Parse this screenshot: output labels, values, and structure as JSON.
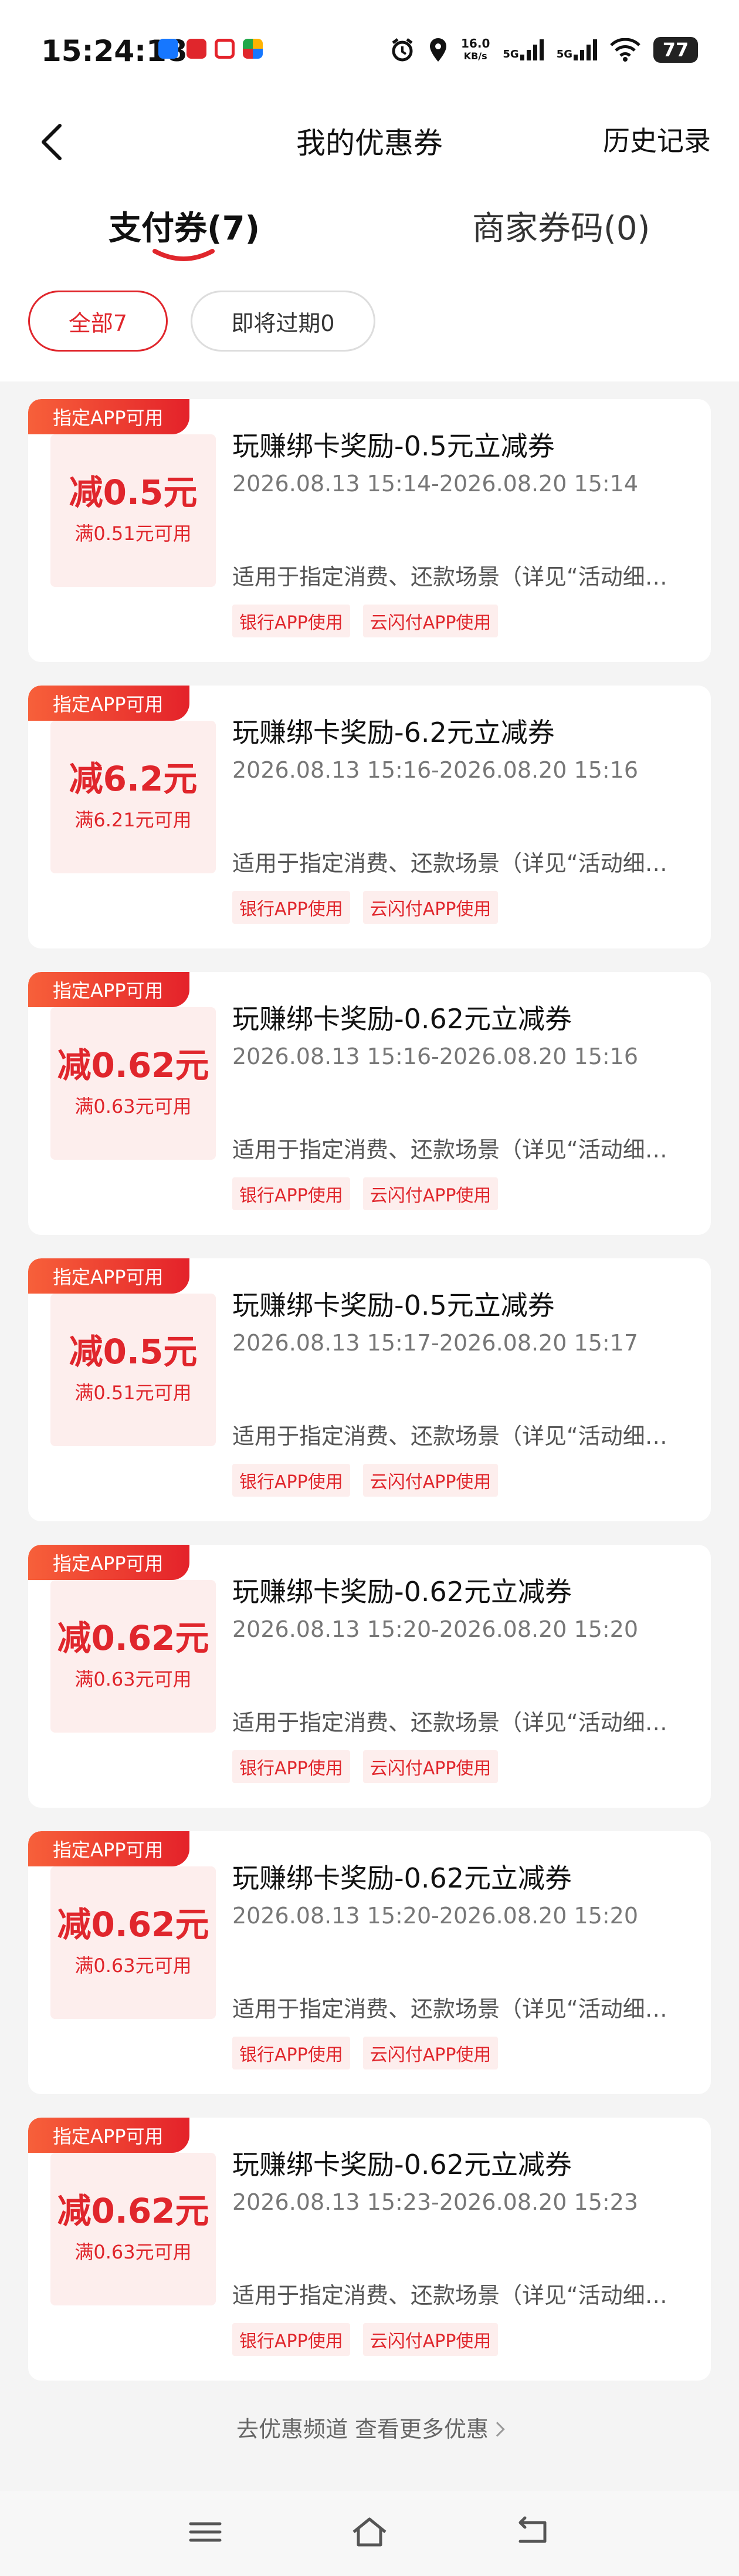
{
  "status_bar": {
    "time": "15:24:18",
    "net_speed_value": "16.0",
    "net_speed_unit": "KB/s",
    "sim1": "5G",
    "sim2": "5G",
    "battery": "77",
    "app_icon_colors": [
      "#1677ff",
      "#e0262c",
      "#e4222a",
      "#ffb300"
    ]
  },
  "header": {
    "title": "我的优惠券",
    "history_label": "历史记录"
  },
  "tabs": [
    {
      "label": "支付券(7)",
      "active": true
    },
    {
      "label": "商家券码(0)",
      "active": false
    }
  ],
  "filters": [
    {
      "label": "全部7",
      "active": true
    },
    {
      "label": "即将过期0",
      "active": false
    }
  ],
  "coupons": [
    {
      "badge": "指定APP可用",
      "amount": "减0.5元",
      "threshold": "满0.51元可用",
      "name": "玩赚绑卡奖励-0.5元立减券",
      "validity": "2026.08.13 15:14-2026.08.20 15:14",
      "description": "适用于指定消费、还款场景（详见“活动细…",
      "tags": [
        "银行APP使用",
        "云闪付APP使用"
      ]
    },
    {
      "badge": "指定APP可用",
      "amount": "减6.2元",
      "threshold": "满6.21元可用",
      "name": "玩赚绑卡奖励-6.2元立减券",
      "validity": "2026.08.13 15:16-2026.08.20 15:16",
      "description": "适用于指定消费、还款场景（详见“活动细…",
      "tags": [
        "银行APP使用",
        "云闪付APP使用"
      ]
    },
    {
      "badge": "指定APP可用",
      "amount": "减0.62元",
      "threshold": "满0.63元可用",
      "name": "玩赚绑卡奖励-0.62元立减券",
      "validity": "2026.08.13 15:16-2026.08.20 15:16",
      "description": "适用于指定消费、还款场景（详见“活动细…",
      "tags": [
        "银行APP使用",
        "云闪付APP使用"
      ]
    },
    {
      "badge": "指定APP可用",
      "amount": "减0.5元",
      "threshold": "满0.51元可用",
      "name": "玩赚绑卡奖励-0.5元立减券",
      "validity": "2026.08.13 15:17-2026.08.20 15:17",
      "description": "适用于指定消费、还款场景（详见“活动细…",
      "tags": [
        "银行APP使用",
        "云闪付APP使用"
      ]
    },
    {
      "badge": "指定APP可用",
      "amount": "减0.62元",
      "threshold": "满0.63元可用",
      "name": "玩赚绑卡奖励-0.62元立减券",
      "validity": "2026.08.13 15:20-2026.08.20 15:20",
      "description": "适用于指定消费、还款场景（详见“活动细…",
      "tags": [
        "银行APP使用",
        "云闪付APP使用"
      ]
    },
    {
      "badge": "指定APP可用",
      "amount": "减0.62元",
      "threshold": "满0.63元可用",
      "name": "玩赚绑卡奖励-0.62元立减券",
      "validity": "2026.08.13 15:20-2026.08.20 15:20",
      "description": "适用于指定消费、还款场景（详见“活动细…",
      "tags": [
        "银行APP使用",
        "云闪付APP使用"
      ]
    },
    {
      "badge": "指定APP可用",
      "amount": "减0.62元",
      "threshold": "满0.63元可用",
      "name": "玩赚绑卡奖励-0.62元立减券",
      "validity": "2026.08.13 15:23-2026.08.20 15:23",
      "description": "适用于指定消费、还款场景（详见“活动细…",
      "tags": [
        "银行APP使用",
        "云闪付APP使用"
      ]
    }
  ],
  "footer": {
    "link_label": "去优惠频道 查看更多优惠"
  },
  "nav_icons": [
    "menu-icon",
    "home-icon",
    "back-icon"
  ],
  "colors": {
    "accent": "#e0262c",
    "badge_gradient_start": "#f7603a",
    "tag_bg": "#fdeeed"
  }
}
